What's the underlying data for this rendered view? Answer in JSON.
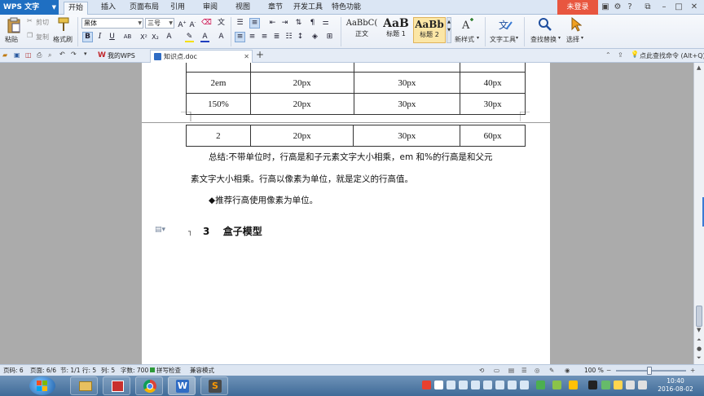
{
  "titlebar": {
    "app_name": "WPS 文字",
    "tabs": [
      "开始",
      "插入",
      "页面布局",
      "引用",
      "审阅",
      "视图",
      "章节",
      "开发工具",
      "特色功能"
    ],
    "active_tab": "开始",
    "login": "未登录"
  },
  "ribbon": {
    "paste": "粘贴",
    "cut": "剪切",
    "copy": "复制",
    "format_painter": "格式刷",
    "font_family": "黑体",
    "font_size": "三号",
    "styles": [
      {
        "sample": "AaBbC(",
        "name": "正文"
      },
      {
        "sample": "AaB",
        "name": "标题 1"
      },
      {
        "sample": "AaBb",
        "name": "标题 2"
      }
    ],
    "new_style": "新样式",
    "text_tools": "文字工具",
    "find_replace": "查找替换",
    "select": "选择",
    "colors": {
      "highlight": "#f5e000",
      "font": "#1f3fbf",
      "accent": "#1f6fc2"
    }
  },
  "doc_tabs": [
    {
      "label": "我的WPS",
      "active": false
    },
    {
      "label": "知识点.doc",
      "active": true
    }
  ],
  "new_tab": "+",
  "command_hint": "点此查找命令 (Alt+Q)",
  "document": {
    "table_upper": [
      [
        "2em",
        "20px",
        "30px",
        "40px"
      ],
      [
        "150%",
        "20px",
        "30px",
        "30px"
      ]
    ],
    "table_lower": [
      [
        "2",
        "20px",
        "30px",
        "60px"
      ]
    ],
    "summary_line1": "总结:不带单位时，行高是和子元素文字大小相乘，em 和%的行高是和父元",
    "summary_line2": "素文字大小相乘。行高以像素为单位，就是定义的行高值。",
    "bullet": "◆推荐行高使用像素为单位。",
    "heading_number": "3",
    "heading_text": "盒子模型"
  },
  "status": {
    "page_num": "页码: 6",
    "pages": "页面: 6/6",
    "section": "节: 1/1",
    "row": "行: 5",
    "col": "列: 5",
    "words": "字数: 700",
    "spell": "拼写检查",
    "compat": "兼容模式",
    "zoom": "100 %"
  },
  "taskbar": {
    "time": "10:40",
    "date": "2016-08-02"
  }
}
